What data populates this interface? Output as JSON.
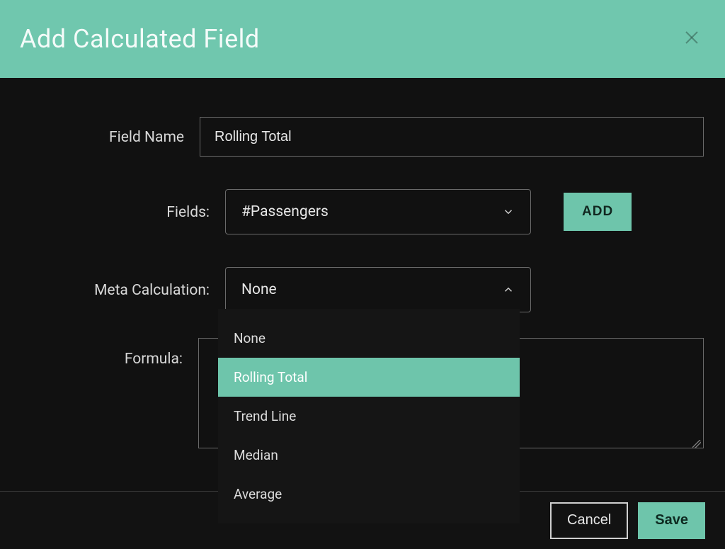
{
  "colors": {
    "accent": "#6ec5ab",
    "header_bg": "#70c7ae",
    "body_bg": "#111111",
    "border": "#6a6a6a",
    "text": "#e6e6e6"
  },
  "header": {
    "title": "Add Calculated Field"
  },
  "form": {
    "field_name": {
      "label": "Field Name",
      "value": "Rolling Total"
    },
    "fields": {
      "label": "Fields:",
      "selected": "#Passengers",
      "add_label": "ADD"
    },
    "meta_calc": {
      "label": "Meta Calculation:",
      "selected": "None",
      "expanded": true,
      "options": [
        {
          "label": "None",
          "highlighted": false
        },
        {
          "label": "Rolling Total",
          "highlighted": true
        },
        {
          "label": "Trend Line",
          "highlighted": false
        },
        {
          "label": "Median",
          "highlighted": false
        },
        {
          "label": "Average",
          "highlighted": false
        }
      ]
    },
    "formula": {
      "label": "Formula:",
      "value": ""
    }
  },
  "footer": {
    "cancel_label": "Cancel",
    "save_label": "Save"
  }
}
